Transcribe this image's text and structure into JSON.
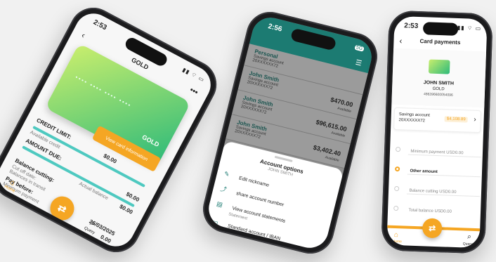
{
  "phone_left": {
    "time": "2:53",
    "card_tier": "GOLD",
    "card_face_tier": "GOLD",
    "view_card_button": "View card information",
    "credit_limit_label": "CREDIT LIMIT:",
    "credit_limit_value": "$0.00",
    "available_credit_label": "Available credit",
    "amount_due_label": "AMOUNT DUE:",
    "amount_due_value": "$0.00",
    "actual_balance_label": "Actual balance",
    "actual_balance_value": "$0.00",
    "balance_cutting_label": "Balance cutting:",
    "cut_off_date_label": "Cut off date:",
    "cut_off_date_value": "Balances in transit",
    "pay_before_label": "Pay before:",
    "minimum_payment_label": "Minimum payment",
    "date_value": "26/03/2025",
    "bottom_amount": "0.00",
    "tab_home": "Home",
    "tab_query": "Query"
  },
  "phone_middle": {
    "time": "2:56",
    "badge": "5G",
    "accounts": [
      {
        "name": "Personal",
        "type": "Savings account",
        "number": "20XXXXXX72",
        "amount": "",
        "caption": ""
      },
      {
        "name": "John Smith",
        "type": "Savings account",
        "number": "20XXXXXX72",
        "amount": "$470.00",
        "caption": "Available"
      },
      {
        "name": "John Smith",
        "type": "Savings account",
        "number": "20XXXXXX72",
        "amount": "$96,615.00",
        "caption": "Available"
      },
      {
        "name": "John Smith",
        "type": "Savings account",
        "number": "20XXXXXX72",
        "amount": "$3,402.40",
        "caption": "Available"
      }
    ],
    "sheet_title": "Account options",
    "sheet_subtitle": "JOHN SMITH",
    "options": [
      {
        "label": "Edit nickname",
        "sub": "",
        "icon": "pencil-icon"
      },
      {
        "label": "share account number",
        "sub": "",
        "icon": "share-icon"
      },
      {
        "label": "View account statements",
        "sub": "Statement",
        "icon": "statement-icon"
      },
      {
        "label": "Standard account / IBAN",
        "sub": "",
        "icon": "card-icon"
      }
    ]
  },
  "phone_right": {
    "time": "2:53",
    "header_title": "Card payments",
    "card_holder": "JOHN SMITH",
    "card_tier": "GOLD",
    "card_number": "486396600054096",
    "account_label": "Savings account",
    "account_number": "20XXXXXX72",
    "account_amount": "$4,108.89",
    "options": [
      {
        "label": "Minimum payment USD0.00",
        "selected": false
      },
      {
        "label": "Other amount",
        "selected": true
      },
      {
        "label": "Balance cutting USD0.00",
        "selected": false
      },
      {
        "label": "Total balance USD0.00",
        "selected": false
      }
    ],
    "tab_home": "Home",
    "tab_query": "Query"
  },
  "colors": {
    "accent": "#f5a623",
    "teal": "#1c7b72",
    "card_gradient_start": "#c9ee6d",
    "card_gradient_end": "#2dba7a"
  }
}
